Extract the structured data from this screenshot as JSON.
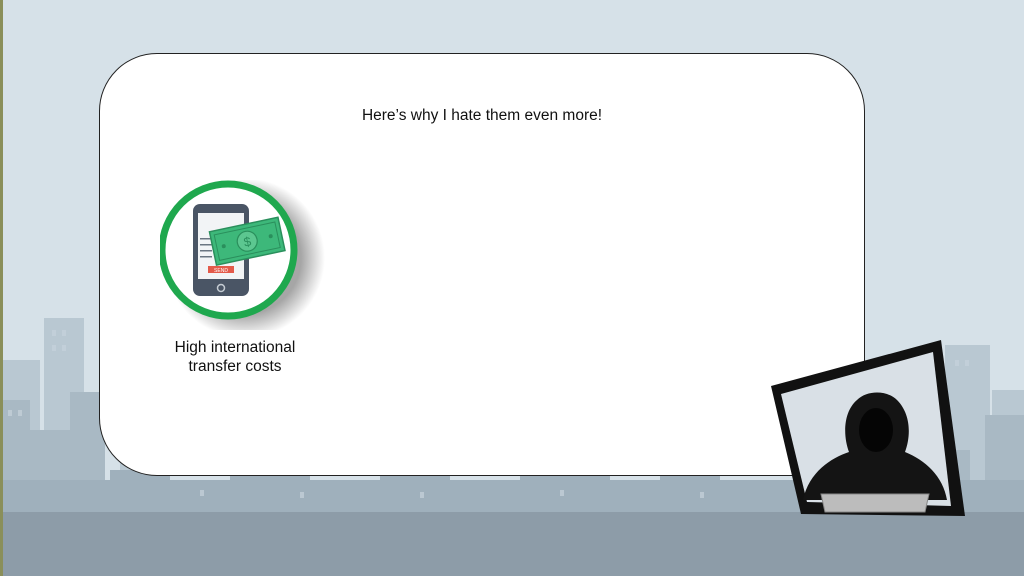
{
  "slide": {
    "heading": "Here’s why I hate them even more!",
    "caption_line1": "High international",
    "caption_line2": "transfer costs",
    "icon_send_label": "SEND"
  },
  "icons": {
    "phone": "phone-money-transfer-icon",
    "hacker": "hooded-hacker-icon"
  },
  "colors": {
    "sky": "#d6e1e8",
    "buildings": "#a9b9c4",
    "ground": "#8d9ca8",
    "ring": "#1fa84e",
    "banknote": "#3db87a"
  }
}
